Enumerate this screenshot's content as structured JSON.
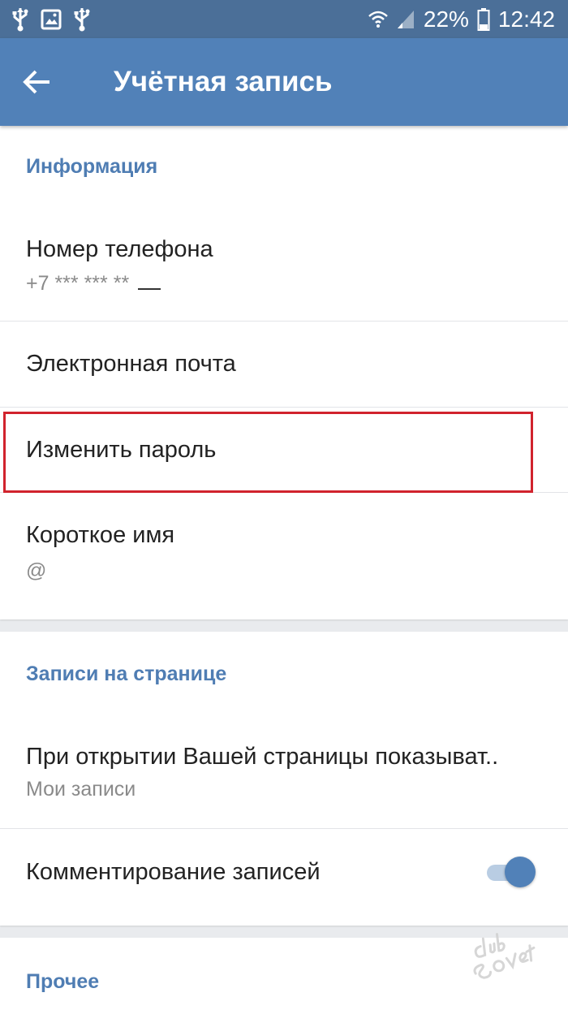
{
  "status_bar": {
    "battery_percent": "22%",
    "time": "12:42",
    "left_icons": [
      "usb-icon",
      "image-icon",
      "usb-icon"
    ],
    "right_icons": [
      "wifi-icon",
      "signal-icon",
      "battery-icon"
    ]
  },
  "toolbar": {
    "back_icon": "arrow-left-icon",
    "title": "Учётная запись"
  },
  "info_section": {
    "header": "Информация",
    "phone": {
      "title": "Номер телефона",
      "value": "+7 *** *** **"
    },
    "email": {
      "title": "Электронная почта"
    },
    "change_password": {
      "title": "Изменить пароль"
    },
    "short_name": {
      "title": "Короткое имя",
      "value": "@"
    }
  },
  "posts_section": {
    "header": "Записи на странице",
    "show_on_open": {
      "title": "При открытии Вашей страницы показыват..",
      "value": "Мои записи"
    },
    "commenting": {
      "title": "Комментирование записей",
      "enabled": true
    }
  },
  "other_section": {
    "header": "Прочее"
  },
  "colors": {
    "status_bar": "#4b6f98",
    "toolbar": "#5181b8",
    "section_header": "#4f7db3",
    "highlight": "#d1232d",
    "toggle_on": "#5181b8"
  }
}
